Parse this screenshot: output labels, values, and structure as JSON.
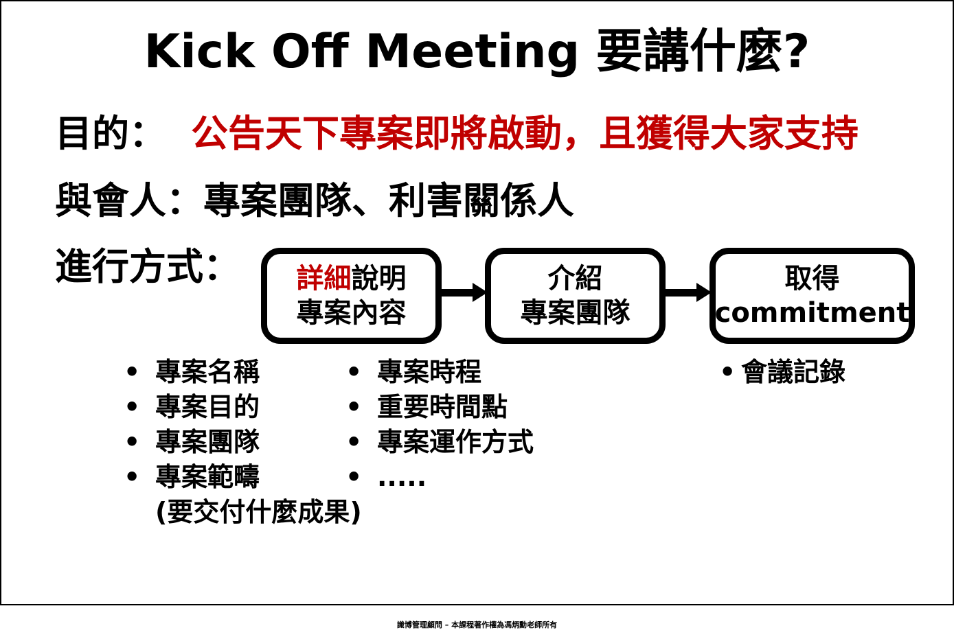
{
  "title": "Kick Off Meeting 要講什麼?",
  "purpose": {
    "label": "目的：",
    "value": "公告天下專案即將啟動，且獲得大家支持"
  },
  "participants": {
    "label": "與會人：",
    "value": "專案團隊、利害關係人"
  },
  "method": {
    "label": "進行方式："
  },
  "flow_steps": [
    {
      "line1_highlight": "詳細",
      "line1_rest": "說明",
      "line2": "專案內容"
    },
    {
      "line1": "介紹",
      "line2": "專案團隊"
    },
    {
      "line1": "取得",
      "line2": "commitment"
    }
  ],
  "bullets_col1": [
    "專案名稱",
    "專案目的",
    "專案團隊",
    "專案範疇"
  ],
  "bullets_col1_sub": "(要交付什麼成果)",
  "bullets_col2": [
    "專案時程",
    "重要時間點",
    "專案運作方式",
    "....."
  ],
  "bullets_col3": [
    "會議記錄"
  ],
  "bullet_symbol": "•",
  "footer": "識博管理顧問 – 本課程著作權為馮炳勳老師所有",
  "colors": {
    "highlight": "#c00000",
    "text": "#000000",
    "background": "#ffffff"
  }
}
